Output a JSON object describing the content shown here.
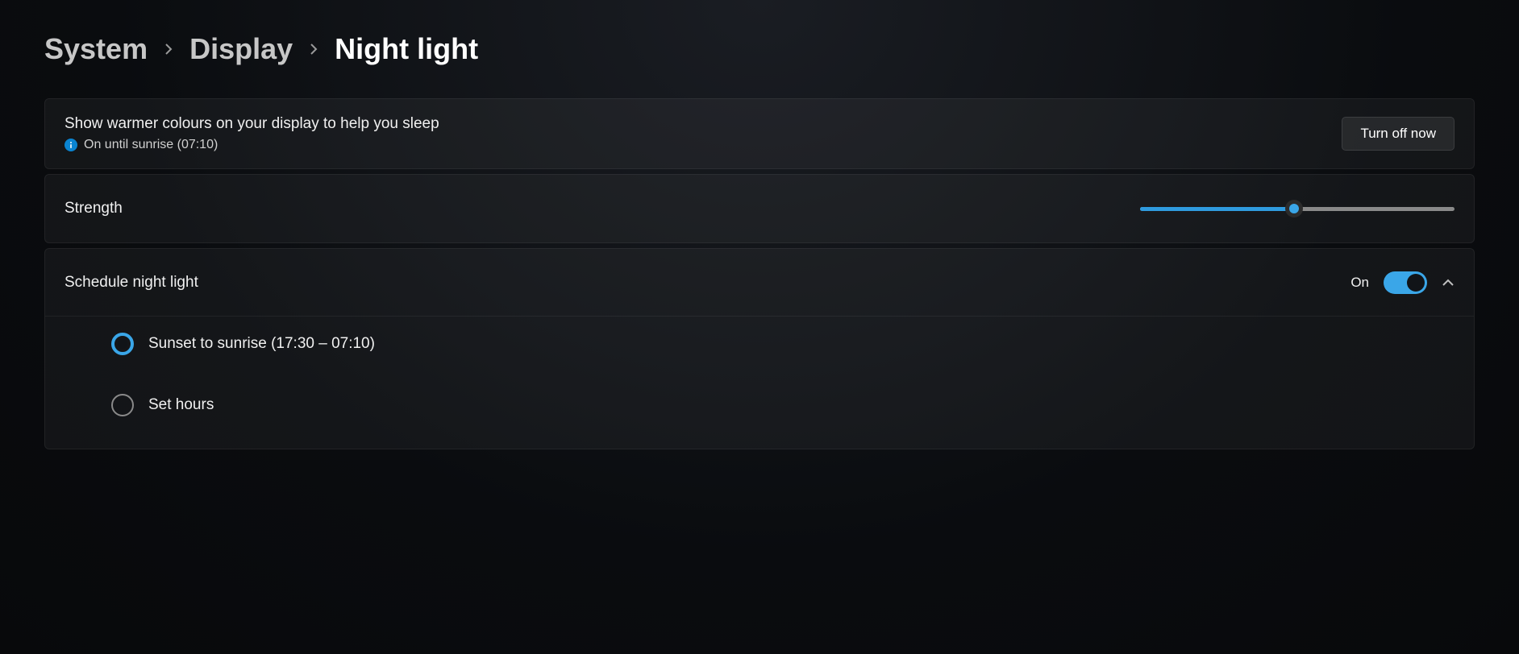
{
  "breadcrumb": {
    "system": "System",
    "display": "Display",
    "current": "Night light"
  },
  "info_card": {
    "description": "Show warmer colours on your display to help you sleep",
    "status": "On until sunrise (07:10)",
    "button": "Turn off now"
  },
  "strength": {
    "label": "Strength",
    "value_percent": 49
  },
  "schedule": {
    "label": "Schedule night light",
    "toggle_state": "On",
    "options": {
      "sunset": "Sunset to sunrise (17:30 – 07:10)",
      "set_hours": "Set hours"
    },
    "selected": "sunset"
  }
}
